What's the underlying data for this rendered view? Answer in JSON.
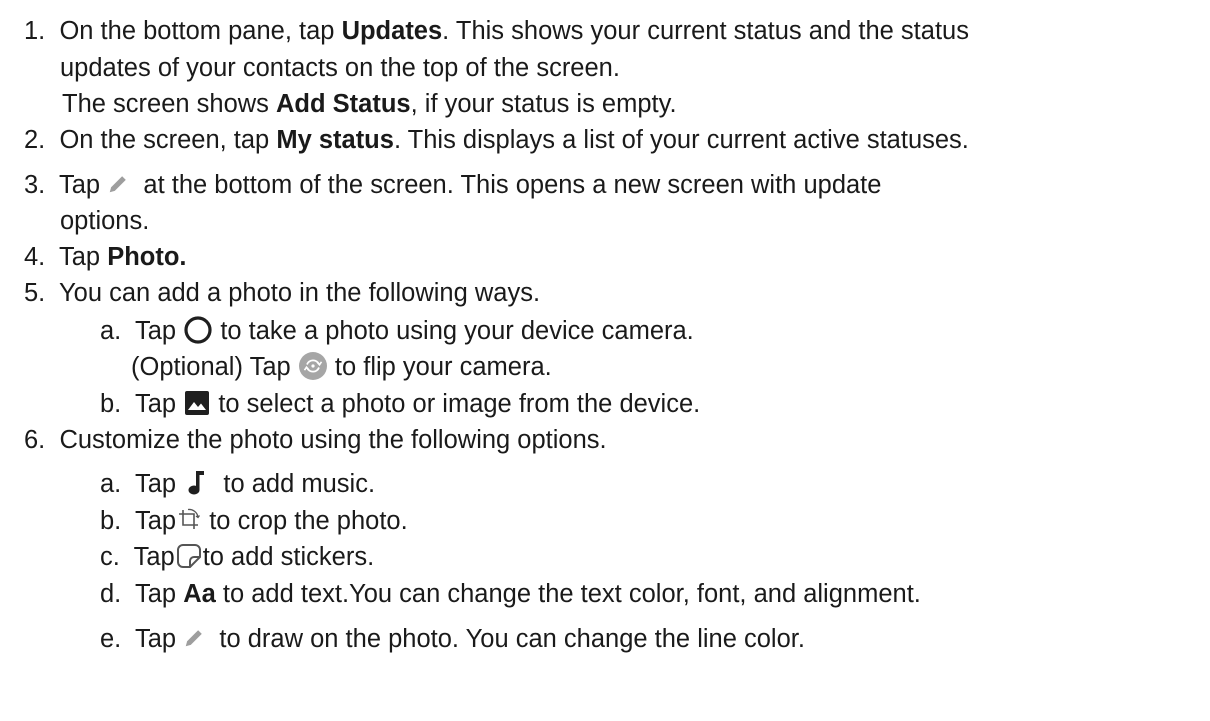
{
  "steps": {
    "s1": {
      "num": "1.",
      "pre": "On the bottom pane, tap ",
      "b1": "Updates",
      "post": ". This shows your current status and the status",
      "line2": "updates of your contacts on the top of the screen.",
      "line3_pre": "The screen shows ",
      "line3_b": "Add Status",
      "line3_post": ", if your status is empty."
    },
    "s2": {
      "num": "2.",
      "pre": "On the screen, tap ",
      "b1": "My status",
      "post": ". This displays a list of your current active statuses."
    },
    "s3": {
      "num": "3.",
      "pre": "Tap",
      "post": "at the bottom of the screen. This opens a new screen with update",
      "line2": "options."
    },
    "s4": {
      "num": "4.",
      "pre": "Tap ",
      "b1": "Photo."
    },
    "s5": {
      "num": "5.",
      "text": "You can add a photo in the following ways.",
      "a_label": "a.",
      "a_pre": "Tap",
      "a_post": "to take a photo using your device camera.",
      "a_opt_pre": "(Optional) Tap",
      "a_opt_post": "to flip your camera.",
      "b_label": "b.",
      "b_pre": "Tap",
      "b_post": "to select a photo or image from the device."
    },
    "s6": {
      "num": "6.",
      "text": "Customize the photo using the following options.",
      "a_label": "a.",
      "a_pre": "Tap",
      "a_post": "to add music.",
      "b_label": "b.",
      "b_pre": "Tap",
      "b_post": "to crop the photo.",
      "c_label": "c.",
      "c_pre": "Tap",
      "c_post": "to add stickers.",
      "d_label": "d.",
      "d_pre": "Tap ",
      "d_b": "Aa",
      "d_post": " to add text.You can change the text color, font, and alignment.",
      "e_label": "e.",
      "e_pre": "Tap",
      "e_post": "to draw on the photo. You can change the line color."
    }
  },
  "icons": {
    "pencil": "pencil-icon",
    "shutter": "shutter-circle-icon",
    "flip": "flip-camera-icon",
    "gallery": "gallery-image-icon",
    "music": "music-note-icon",
    "crop": "crop-rotate-icon",
    "sticker": "sticker-icon"
  },
  "colors": {
    "text": "#1a1a1a",
    "icon_gray": "#9e9e9e",
    "icon_dark": "#1f1f1f"
  }
}
